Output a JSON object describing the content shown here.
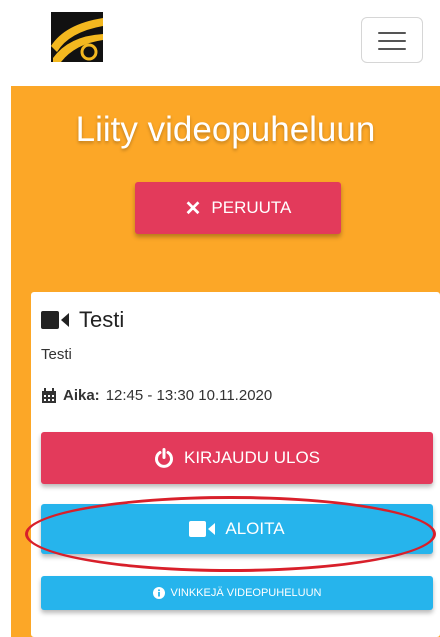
{
  "header": {
    "logo_icon": "logo-emblem-icon",
    "menu_icon": "hamburger-menu-icon"
  },
  "main": {
    "title": "Liity videopuheluun",
    "cancel_label": "PERUUTA",
    "cancel_icon": "x-icon",
    "background_color": "#fca727"
  },
  "meeting": {
    "title": "Testi",
    "title_icon": "video-camera-icon",
    "description": "Testi",
    "time_label": "Aika:",
    "time_value": "12:45 - 13:30 10.11.2020",
    "time_icon": "calendar-icon"
  },
  "actions": {
    "logout_label": "KIRJAUDU ULOS",
    "logout_icon": "power-icon",
    "start_label": "ALOITA",
    "start_icon": "video-camera-icon",
    "tips_label": "VINKKEJÄ VIDEOPUHELUUN",
    "tips_icon": "info-icon"
  },
  "colors": {
    "danger": "#e33a5b",
    "primary": "#26b4ec",
    "annotation": "#d81f2a"
  }
}
